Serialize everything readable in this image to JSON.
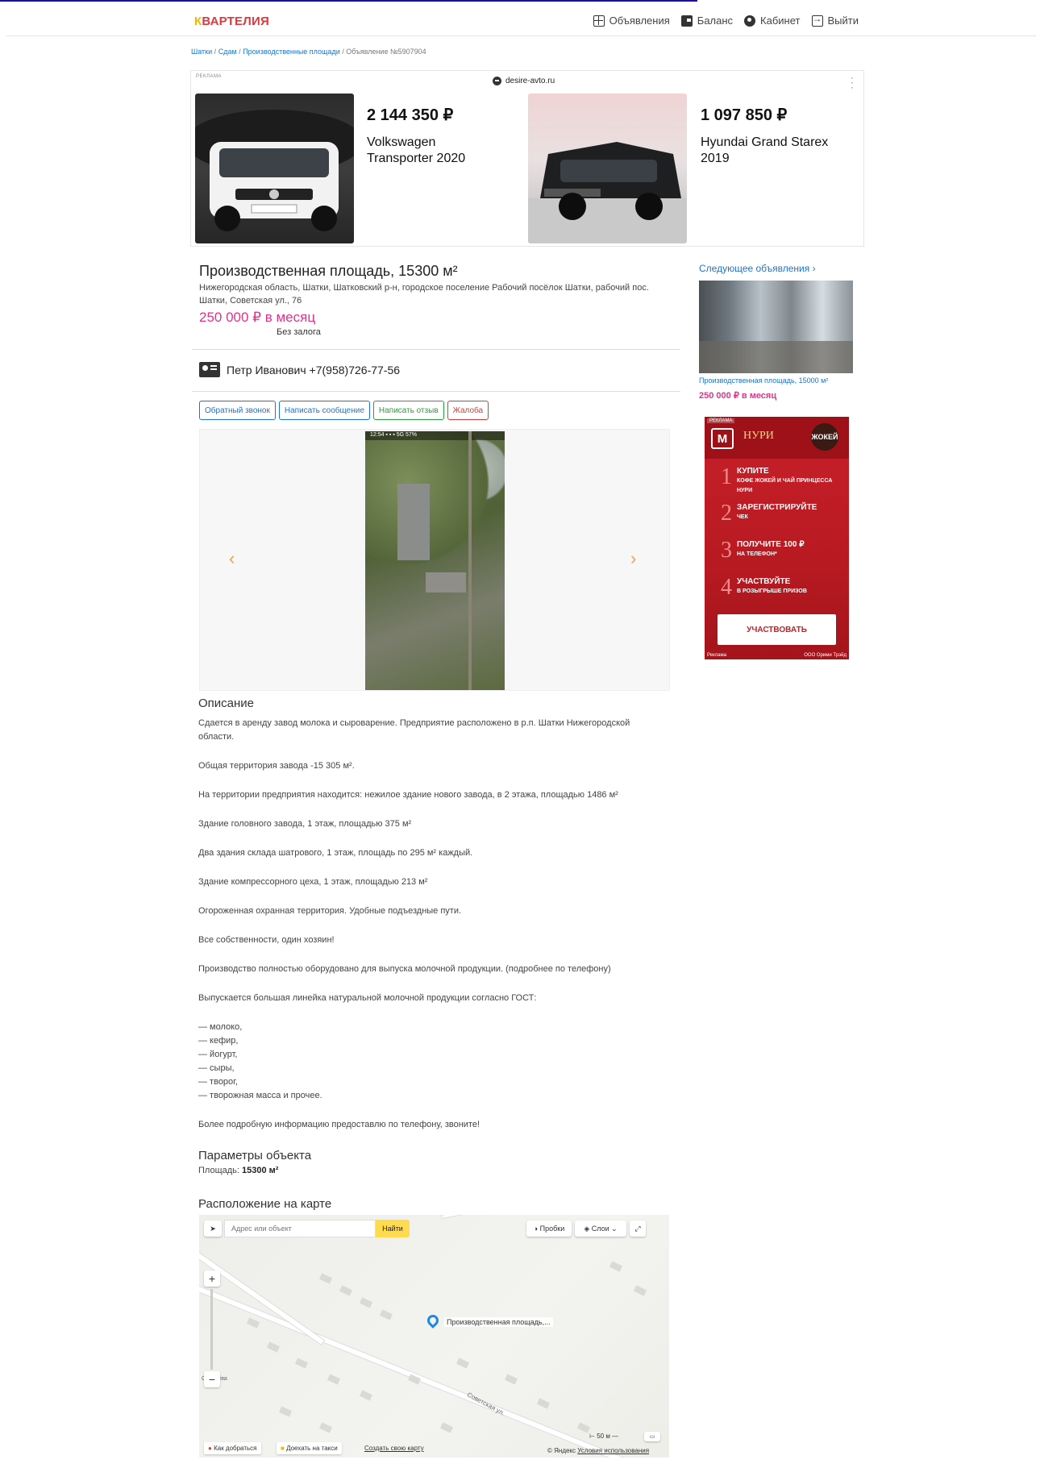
{
  "header": {
    "logo": "ВАРТЕЛИЯ",
    "logo_first": "К",
    "nav": [
      {
        "label": "Объявления",
        "icon": "grid-icon"
      },
      {
        "label": "Баланс",
        "icon": "wallet-icon"
      },
      {
        "label": "Кабинет",
        "icon": "user-icon"
      },
      {
        "label": "Выйти",
        "icon": "exit-icon"
      }
    ]
  },
  "breadcrumb": {
    "items": [
      "Шатки",
      "Сдам",
      "Производственные площади"
    ],
    "current": "Объявление №5907904",
    "sep": "/"
  },
  "ad_top": {
    "label": "РЕКЛАМА",
    "domain": "desire-avto.ru",
    "cars": [
      {
        "price": "2 144 350 ₽",
        "name": "Volkswagen Transporter 2020"
      },
      {
        "price": "1 097 850 ₽",
        "name": "Hyundai Grand Starex 2019"
      }
    ]
  },
  "listing": {
    "title": "Производственная площадь, 15300 м²",
    "address": "Нижегородская область, Шатки, Шатковский р-н, городское поселение Рабочий посёлок Шатки, рабочий пос. Шатки, Советская ул., 76",
    "price": "250 000 ₽ в месяц",
    "deposit": "Без залога",
    "contact": "Петр Иванович +7(958)726-77-56",
    "buttons": {
      "callback": "Обратный звонок",
      "message": "Написать сообщение",
      "review": "Написать отзыв",
      "complaint": "Жалоба"
    }
  },
  "gallery": {
    "status_bar": "12:54 ▪ ▪ ▪   5G 57%"
  },
  "description": {
    "title": "Описание",
    "paragraphs": [
      "Сдается в аренду завод молока и сыроварение. Предприятие расположено в р.п. Шатки Нижегородской области.",
      "Общая территория завода  -15 305 м².",
      "На территории предприятия находится: нежилое здание нового завода, в 2 этажа, площадью 1486 м²",
      "Здание головного завода, 1 этаж, площадью 375 м²",
      "Два здания склада шатрового, 1 этаж, площадь по 295 м² каждый.",
      "Здание компрессорного цеха, 1 этаж, площадью 213 м²",
      "Огороженная охранная территория. Удобные подъездные пути.",
      "Все собственности, один хозяин!",
      "Производство полностью оборудовано для выпуска молочной продукции. (подробнее по телефону)",
      "Выпускается большая линейка натуральной молочной продукции согласно ГОСТ:"
    ],
    "list": [
      "— молоко,",
      "— кефир,",
      "— йогурт,",
      "— сыры,",
      "— творог,",
      "— творожная  масса и прочее."
    ],
    "closing": "Более подробную информацию предоставлю по телефону, звоните!"
  },
  "params": {
    "title": "Параметры объекта",
    "area_label": "Площадь:",
    "area_value": "15300 м²"
  },
  "map": {
    "title": "Расположение на карте",
    "search_placeholder": "Адрес или объект",
    "find": "Найти",
    "traffic": "Пробки",
    "layers": "Слои",
    "pin_label": "Производственная площадь,...",
    "street": "Советская ул.",
    "route": "Как добраться",
    "taxi": "Доехать на такси",
    "create": "Создать свою карту",
    "scale": "50 м",
    "copyright": "© Яндекс",
    "terms": "Условия использования",
    "place": "Савичева"
  },
  "sidebar": {
    "next_link": "Следующее объявления ›",
    "card_caption": "Производственная площадь, 15000 м²",
    "card_price": "250 000 ₽ в месяц"
  },
  "ad_side": {
    "tag": "РЕКЛАМА",
    "brand": "НУРИ",
    "brand2": "ЖОКЕЙ",
    "steps": [
      {
        "n": "1",
        "t": "КУПИТЕ",
        "s": "КОФЕ ЖОКЕЙ И ЧАЙ ПРИНЦЕССА НУРИ"
      },
      {
        "n": "2",
        "t": "ЗАРЕГИСТРИРУЙТЕ",
        "s": "ЧЕК"
      },
      {
        "n": "3",
        "t": "ПОЛУЧИТЕ 100 ₽",
        "s": "НА ТЕЛЕФОН*"
      },
      {
        "n": "4",
        "t": "УЧАСТВУЙТЕ",
        "s": "В РОЗЫГРЫШЕ ПРИЗОВ"
      }
    ],
    "cta": "УЧАСТВОВАТЬ",
    "foot_left": "Реклама",
    "foot_right": "ООО Орими Трэйд"
  },
  "colors": {
    "accent": "#1e74c8",
    "price": "#e0338a",
    "logo": "#e0383e"
  }
}
